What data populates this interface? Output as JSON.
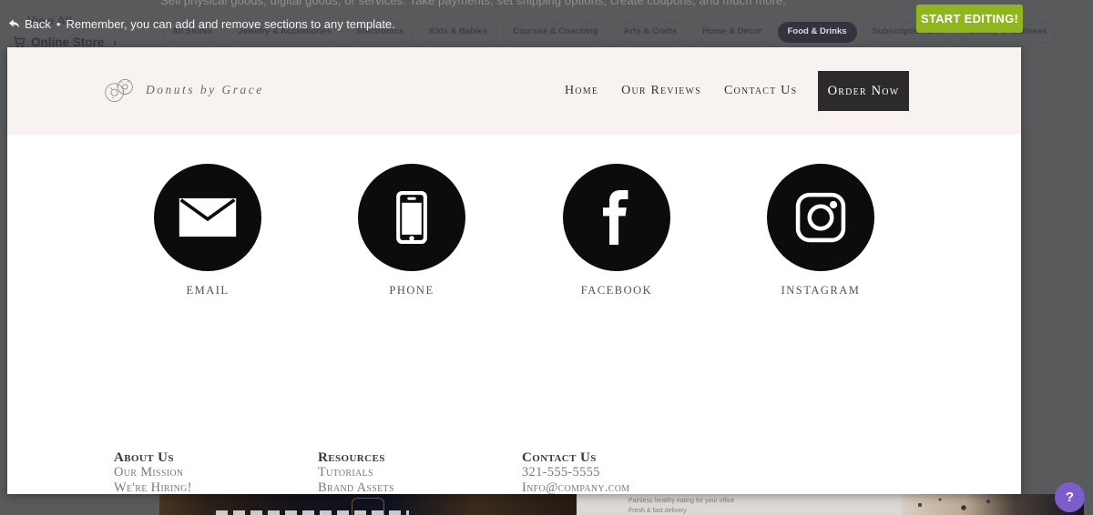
{
  "overlay": {
    "back_label": "Back",
    "bullet": "•",
    "message": "Remember, you can add and remove sections to any template.",
    "start_editing_label": "START EDITING!"
  },
  "backdrop": {
    "tagline": "Sell physical goods, digital goods, or services. Take payments, set shipping options, create coupons, and much more.",
    "view_all_label": "View All",
    "breadcrumb": {
      "label": "Online Store",
      "chevron": "›"
    },
    "filters": [
      {
        "label": "All Stores",
        "selected": false
      },
      {
        "label": "Jewelry & Accessories",
        "selected": false
      },
      {
        "label": "Electronics",
        "selected": false
      },
      {
        "label": "Kids & Babies",
        "selected": false
      },
      {
        "label": "Courses & Coaching",
        "selected": false
      },
      {
        "label": "Arts & Crafts",
        "selected": false
      },
      {
        "label": "Home & Decor",
        "selected": false
      },
      {
        "label": "Food & Drinks",
        "selected": true
      },
      {
        "label": "Subscription Box",
        "selected": false
      },
      {
        "label": "Beauty & Wellness",
        "selected": false
      }
    ],
    "thumbnails": {
      "card_line1": "Painless healthy eating for your office",
      "card_line2": "Fresh & fast delivery"
    }
  },
  "template": {
    "brand": "Donuts by Grace",
    "nav": [
      {
        "label": "Home"
      },
      {
        "label": "Our Reviews"
      },
      {
        "label": "Contact Us"
      }
    ],
    "order_now_label": "Order Now",
    "social": [
      {
        "icon": "email-icon",
        "label": "EMAIL"
      },
      {
        "icon": "phone-icon",
        "label": "PHONE"
      },
      {
        "icon": "facebook-icon",
        "label": "FACEBOOK"
      },
      {
        "icon": "instagram-icon",
        "label": "INSTAGRAM"
      }
    ],
    "footer": {
      "columns": [
        {
          "heading": "About Us",
          "items": [
            "Our Mission",
            "We're Hiring!"
          ]
        },
        {
          "heading": "Resources",
          "items": [
            "Tutorials",
            "Brand Assets"
          ]
        },
        {
          "heading": "Contact Us",
          "items": [
            "321-555-5555",
            "Info@company.com"
          ]
        }
      ]
    }
  },
  "help": {
    "label": "?"
  },
  "colors": {
    "page_overlay_gray": "#595A5C",
    "accent_green": "#8FB71D",
    "help_purple": "#7B5EC9",
    "pill_selected_bg": "#343440",
    "template_header_bg": "#F8F3F1",
    "social_icon_bg": "#0C0C0C",
    "order_now_bg": "#2D2A2B"
  }
}
